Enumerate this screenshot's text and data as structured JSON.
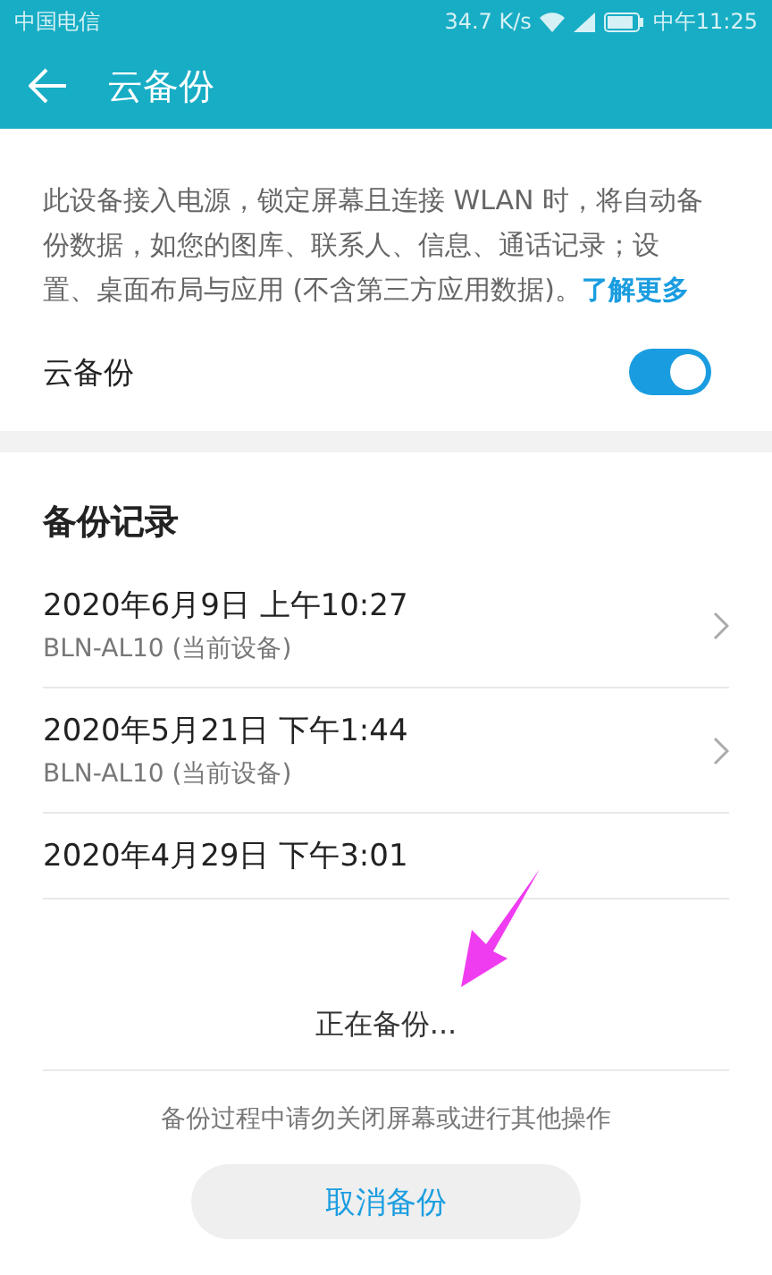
{
  "status_bar": {
    "carrier": "中国电信",
    "speed": "34.7 K/s",
    "time": "中午11:25"
  },
  "header": {
    "title": "云备份"
  },
  "description": {
    "text": "此设备接入电源，锁定屏幕且连接 WLAN 时，将自动备份数据，如您的图库、联系人、信息、通话记录；设置、桌面布局与应用 (不含第三方应用数据)。",
    "link": "了解更多"
  },
  "toggle": {
    "label": "云备份",
    "on": true
  },
  "records": {
    "title": "备份记录",
    "items": [
      {
        "date": "2020年6月9日 上午10:27",
        "device": "BLN-AL10 (当前设备)"
      },
      {
        "date": "2020年5月21日 下午1:44",
        "device": "BLN-AL10 (当前设备)"
      },
      {
        "date": "2020年4月29日 下午3:01"
      }
    ]
  },
  "progress": {
    "status": "正在备份...",
    "hint": "备份过程中请勿关闭屏幕或进行其他操作",
    "button": "取消备份"
  }
}
